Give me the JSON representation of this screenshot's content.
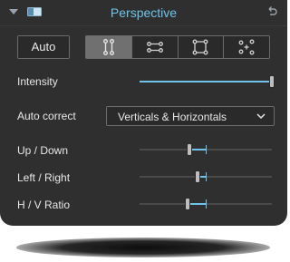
{
  "header": {
    "title": "Perspective",
    "icons": {
      "collapse": "triangle-down-icon",
      "panel_toggle": "panel-toggle-icon",
      "reset": "reset-icon"
    }
  },
  "toolbar": {
    "auto_label": "Auto",
    "modes": [
      {
        "icon": "vertical-guides-icon",
        "active": true
      },
      {
        "icon": "horizontal-guides-icon",
        "active": false
      },
      {
        "icon": "rectangle-guides-icon",
        "active": false
      },
      {
        "icon": "point-guides-icon",
        "active": false
      }
    ]
  },
  "intensity": {
    "label": "Intensity",
    "value": 1.0
  },
  "auto_correct": {
    "label": "Auto correct",
    "selected": "Verticals & Horizontals",
    "icon": "chevron-down-icon"
  },
  "sliders": [
    {
      "key": "up_down",
      "label": "Up / Down",
      "value": 0.25
    },
    {
      "key": "left_right",
      "label": "Left / Right",
      "value": 0.13
    },
    {
      "key": "hv_ratio",
      "label": "H / V Ratio",
      "value": 0.27
    }
  ],
  "colors": {
    "accent": "#6fc3e8",
    "panel": "#2f2f2f",
    "text": "#e8e8e8"
  }
}
